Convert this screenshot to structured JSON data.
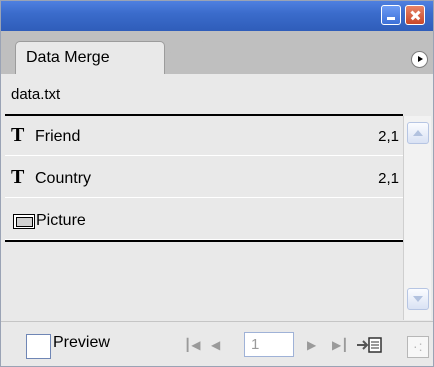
{
  "panel": {
    "tab_label": "Data Merge",
    "source_file": "data.txt",
    "fields": [
      {
        "icon": "text-field-icon",
        "glyph": "T",
        "label": "Friend",
        "value": "2,1"
      },
      {
        "icon": "text-field-icon",
        "glyph": "T",
        "label": "Country",
        "value": "2,1"
      },
      {
        "icon": "image-field-icon",
        "glyph": "",
        "label": "Picture",
        "value": ""
      }
    ]
  },
  "footer": {
    "preview_label": "Preview",
    "preview_checked": false,
    "record_number": "1"
  },
  "icons": {
    "minimize": "minimize-icon",
    "close": "close-icon",
    "panel_menu": "panel-menu-icon",
    "first_record": "first-record-icon",
    "previous_record": "previous-record-icon",
    "next_record": "next-record-icon",
    "last_record": "last-record-icon",
    "create_merged_document": "create-merged-document-icon",
    "resize_grip": "resize-grip-icon"
  },
  "colors": {
    "titlebar": "#3b6ccc",
    "close_button": "#c8472a",
    "panel_background": "#e9e9e9",
    "tabstrip": "#bfbfbf"
  }
}
